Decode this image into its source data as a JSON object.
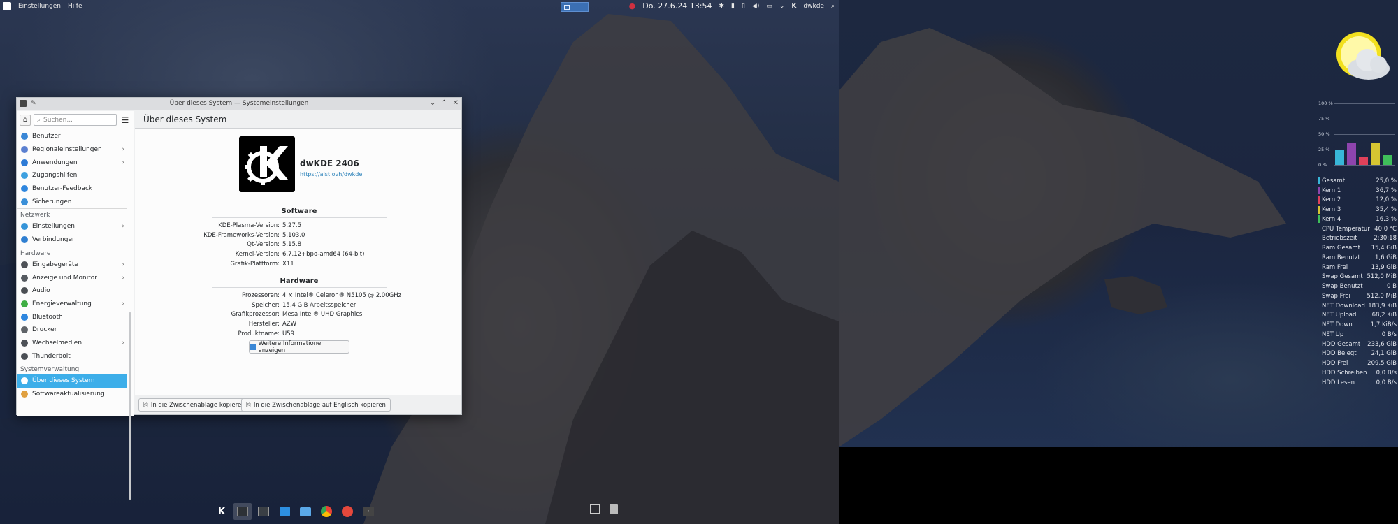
{
  "top_panel": {
    "menu": [
      "Einstellungen",
      "Hilfe"
    ],
    "clock": "Do. 27.6.24 13:54",
    "username": "dwkde"
  },
  "window": {
    "title": "Über dieses System — Systemeinstellungen",
    "search_placeholder": "Suchen...",
    "page_title": "Über dieses System",
    "sidebar": {
      "items_top": [
        {
          "label": "Benutzer",
          "color": "#3a87d6",
          "chevron": false
        },
        {
          "label": "Regionaleinstellungen",
          "color": "#5a7fd0",
          "chevron": true
        },
        {
          "label": "Anwendungen",
          "color": "#2d7bd6",
          "chevron": true
        },
        {
          "label": "Zugangshilfen",
          "color": "#3da0e0",
          "chevron": false
        },
        {
          "label": "Benutzer-Feedback",
          "color": "#2e86de",
          "chevron": false
        },
        {
          "label": "Sicherungen",
          "color": "#3a8fd8",
          "chevron": false
        }
      ],
      "section_network": "Netzwerk",
      "items_network": [
        {
          "label": "Einstellungen",
          "color": "#3594d8",
          "chevron": true
        },
        {
          "label": "Verbindungen",
          "color": "#2f7fd1",
          "chevron": false
        }
      ],
      "section_hardware": "Hardware",
      "items_hardware": [
        {
          "label": "Eingabegeräte",
          "color": "#4e5257",
          "chevron": true
        },
        {
          "label": "Anzeige und Monitor",
          "color": "#555a60",
          "chevron": true
        },
        {
          "label": "Audio",
          "color": "#4a4e53",
          "chevron": false
        },
        {
          "label": "Energieverwaltung",
          "color": "#3fae44",
          "chevron": true
        },
        {
          "label": "Bluetooth",
          "color": "#2e86de",
          "chevron": false
        },
        {
          "label": "Drucker",
          "color": "#5f6368",
          "chevron": false
        },
        {
          "label": "Wechselmedien",
          "color": "#4d5157",
          "chevron": true
        },
        {
          "label": "Thunderbolt",
          "color": "#4b4f55",
          "chevron": false
        }
      ],
      "section_system": "Systemverwaltung",
      "items_system": [
        {
          "label": "Über dieses System",
          "color": "#ffffff",
          "chevron": false,
          "selected": true
        },
        {
          "label": "Softwareaktualisierung",
          "color": "#e0a040",
          "chevron": false
        }
      ]
    },
    "distro": {
      "name": "dwKDE 2406",
      "link": "https://alst.ovh/dwkde"
    },
    "software_title": "Software",
    "software": [
      {
        "k": "KDE-Plasma-Version:",
        "v": "5.27.5"
      },
      {
        "k": "KDE-Frameworks-Version:",
        "v": "5.103.0"
      },
      {
        "k": "Qt-Version:",
        "v": "5.15.8"
      },
      {
        "k": "Kernel-Version:",
        "v": "6.7.12+bpo-amd64 (64-bit)"
      },
      {
        "k": "Grafik-Plattform:",
        "v": "X11"
      }
    ],
    "hardware_title": "Hardware",
    "hardware": [
      {
        "k": "Prozessoren:",
        "v": "4 × Intel® Celeron® N5105 @ 2.00GHz"
      },
      {
        "k": "Speicher:",
        "v": "15,4 GiB Arbeitsspeicher"
      },
      {
        "k": "Grafikprozessor:",
        "v": "Mesa Intel® UHD Graphics"
      },
      {
        "k": "Hersteller:",
        "v": "AZW"
      },
      {
        "k": "Produktname:",
        "v": "U59"
      }
    ],
    "more_button": "Weitere Informationen anzeigen",
    "copy_button": "In die Zwischenablage kopieren",
    "copy_en_button": "In die Zwischenablage auf Englisch kopieren"
  },
  "conky": {
    "axis": [
      "100 %",
      "75 %",
      "50 %",
      "25 %",
      "0 %"
    ],
    "cpu_bars": [
      {
        "value": 0.25,
        "color": "#38b6d8"
      },
      {
        "value": 0.367,
        "color": "#8e44ad"
      },
      {
        "value": 0.12,
        "color": "#e0415a"
      },
      {
        "value": 0.354,
        "color": "#d6c532"
      },
      {
        "value": 0.163,
        "color": "#3fbf5a"
      }
    ],
    "stats": [
      {
        "label": "Gesamt",
        "value": "25,0 %",
        "marker": "#38b6d8"
      },
      {
        "label": "Kern 1",
        "value": "36,7 %",
        "marker": "#8e44ad"
      },
      {
        "label": "Kern 2",
        "value": "12,0 %",
        "marker": "#e0415a"
      },
      {
        "label": "Kern 3",
        "value": "35,4 %",
        "marker": "#d6c532"
      },
      {
        "label": "Kern 4",
        "value": "16,3 %",
        "marker": "#3fbf5a"
      },
      {
        "label": "CPU Temperatur",
        "value": "40,0 °C",
        "marker": ""
      },
      {
        "label": "Betriebszeit",
        "value": "2:30:18",
        "marker": ""
      },
      {
        "label": "Ram Gesamt",
        "value": "15,4 GiB",
        "marker": ""
      },
      {
        "label": "Ram Benutzt",
        "value": "1,6 GiB",
        "marker": ""
      },
      {
        "label": "Ram Frei",
        "value": "13,9 GiB",
        "marker": ""
      },
      {
        "label": "Swap Gesamt",
        "value": "512,0 MiB",
        "marker": ""
      },
      {
        "label": "Swap Benutzt",
        "value": "0 B",
        "marker": ""
      },
      {
        "label": "Swap Frei",
        "value": "512,0 MiB",
        "marker": ""
      },
      {
        "label": "NET Download",
        "value": "183,9 KiB",
        "marker": ""
      },
      {
        "label": "NET Upload",
        "value": "68,2 KiB",
        "marker": ""
      },
      {
        "label": "NET Down",
        "value": "1,7 KiB/s",
        "marker": ""
      },
      {
        "label": "NET Up",
        "value": "0 B/s",
        "marker": ""
      },
      {
        "label": "HDD Gesamt",
        "value": "233,6 GiB",
        "marker": ""
      },
      {
        "label": "HDD Belegt",
        "value": "24,1 GiB",
        "marker": ""
      },
      {
        "label": "HDD Frei",
        "value": "209,5 GiB",
        "marker": ""
      },
      {
        "label": "HDD Schreiben",
        "value": "0,0 B/s",
        "marker": ""
      },
      {
        "label": "HDD Lesen",
        "value": "0,0 B/s",
        "marker": ""
      }
    ]
  }
}
